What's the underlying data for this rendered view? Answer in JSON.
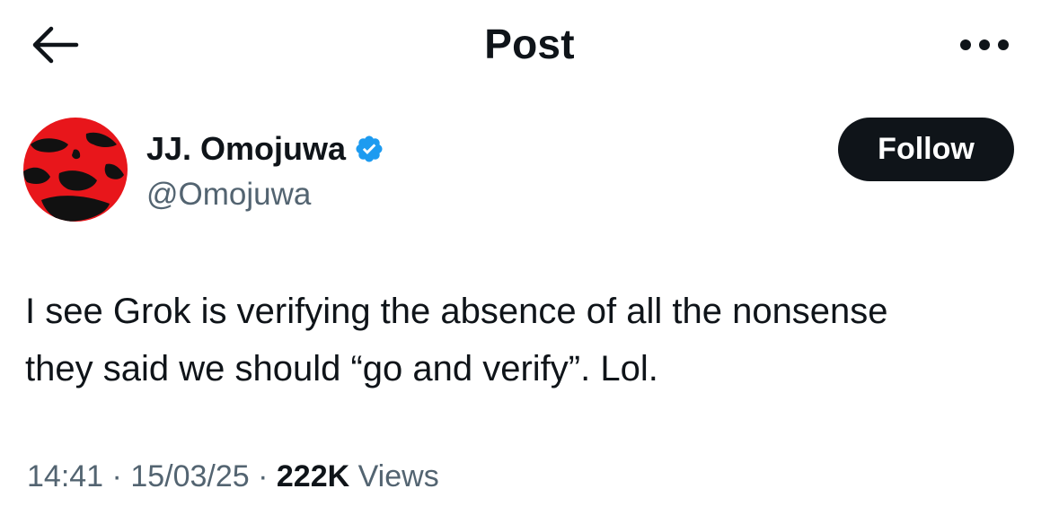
{
  "header": {
    "title": "Post",
    "back_icon": "arrow-left-icon",
    "more_icon": "more-horizontal-icon"
  },
  "author": {
    "display_name": "JJ. Omojuwa",
    "handle": "@Omojuwa",
    "verified_icon": "verified-badge-icon",
    "verified_color": "#1d9bf0",
    "avatar_colors": [
      "#e8161b",
      "#111111"
    ]
  },
  "follow_button": {
    "label": "Follow"
  },
  "tweet": {
    "line1": "I see Grok is verifying the absence of all the nonsense",
    "line2": "they said we should “go and verify”. Lol."
  },
  "meta": {
    "time": "14:41",
    "sep1": " · ",
    "date": "15/03/25",
    "sep2": " · ",
    "views_count": "222K",
    "views_label": " Views"
  },
  "colors": {
    "text": "#0f1419",
    "secondary": "#536471",
    "button_bg": "#0f1419",
    "button_text": "#ffffff"
  }
}
